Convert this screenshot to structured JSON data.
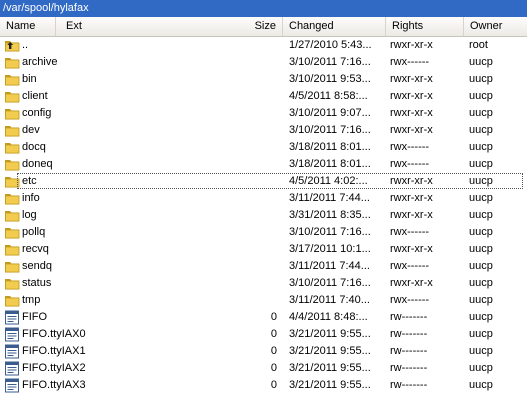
{
  "path": "/var/spool/hylafax",
  "columns": {
    "name": "Name",
    "ext": "Ext",
    "size": "Size",
    "changed": "Changed",
    "rights": "Rights",
    "owner": "Owner"
  },
  "colors": {
    "accent": "#316ac5",
    "folder": "#f2cc4e",
    "folder_dark": "#c49a1b"
  },
  "rows": [
    {
      "name": "..",
      "size": "",
      "changed": "1/27/2010 5:43...",
      "rights": "rwxr-xr-x",
      "owner": "root",
      "icon": "parent-folder-icon"
    },
    {
      "name": "archive",
      "size": "",
      "changed": "3/10/2011 7:16...",
      "rights": "rwx------",
      "owner": "uucp",
      "icon": "folder-icon"
    },
    {
      "name": "bin",
      "size": "",
      "changed": "3/10/2011 9:53...",
      "rights": "rwxr-xr-x",
      "owner": "uucp",
      "icon": "folder-icon"
    },
    {
      "name": "client",
      "size": "",
      "changed": "4/5/2011 8:58:...",
      "rights": "rwxr-xr-x",
      "owner": "uucp",
      "icon": "folder-icon"
    },
    {
      "name": "config",
      "size": "",
      "changed": "3/10/2011 9:07...",
      "rights": "rwxr-xr-x",
      "owner": "uucp",
      "icon": "folder-icon"
    },
    {
      "name": "dev",
      "size": "",
      "changed": "3/10/2011 7:16...",
      "rights": "rwxr-xr-x",
      "owner": "uucp",
      "icon": "folder-icon"
    },
    {
      "name": "docq",
      "size": "",
      "changed": "3/18/2011 8:01...",
      "rights": "rwx------",
      "owner": "uucp",
      "icon": "folder-icon"
    },
    {
      "name": "doneq",
      "size": "",
      "changed": "3/18/2011 8:01...",
      "rights": "rwx------",
      "owner": "uucp",
      "icon": "folder-icon"
    },
    {
      "name": "etc",
      "size": "",
      "changed": "4/5/2011 4:02:...",
      "rights": "rwxr-xr-x",
      "owner": "uucp",
      "icon": "folder-icon",
      "focused": true
    },
    {
      "name": "info",
      "size": "",
      "changed": "3/11/2011 7:44...",
      "rights": "rwxr-xr-x",
      "owner": "uucp",
      "icon": "folder-icon"
    },
    {
      "name": "log",
      "size": "",
      "changed": "3/31/2011 8:35...",
      "rights": "rwxr-xr-x",
      "owner": "uucp",
      "icon": "folder-icon"
    },
    {
      "name": "pollq",
      "size": "",
      "changed": "3/10/2011 7:16...",
      "rights": "rwx------",
      "owner": "uucp",
      "icon": "folder-icon"
    },
    {
      "name": "recvq",
      "size": "",
      "changed": "3/17/2011 10:1...",
      "rights": "rwxr-xr-x",
      "owner": "uucp",
      "icon": "folder-icon"
    },
    {
      "name": "sendq",
      "size": "",
      "changed": "3/11/2011 7:44...",
      "rights": "rwx------",
      "owner": "uucp",
      "icon": "folder-icon"
    },
    {
      "name": "status",
      "size": "",
      "changed": "3/10/2011 7:16...",
      "rights": "rwxr-xr-x",
      "owner": "uucp",
      "icon": "folder-icon"
    },
    {
      "name": "tmp",
      "size": "",
      "changed": "3/11/2011 7:40...",
      "rights": "rwx------",
      "owner": "uucp",
      "icon": "folder-icon"
    },
    {
      "name": "FIFO",
      "size": "0",
      "changed": "4/4/2011 8:48:...",
      "rights": "rw-------",
      "owner": "uucp",
      "icon": "fifo-file-icon"
    },
    {
      "name": "FIFO.ttyIAX0",
      "size": "0",
      "changed": "3/21/2011 9:55...",
      "rights": "rw-------",
      "owner": "uucp",
      "icon": "fifo-file-icon"
    },
    {
      "name": "FIFO.ttyIAX1",
      "size": "0",
      "changed": "3/21/2011 9:55...",
      "rights": "rw-------",
      "owner": "uucp",
      "icon": "fifo-file-icon"
    },
    {
      "name": "FIFO.ttyIAX2",
      "size": "0",
      "changed": "3/21/2011 9:55...",
      "rights": "rw-------",
      "owner": "uucp",
      "icon": "fifo-file-icon"
    },
    {
      "name": "FIFO.ttyIAX3",
      "size": "0",
      "changed": "3/21/2011 9:55...",
      "rights": "rw-------",
      "owner": "uucp",
      "icon": "fifo-file-icon"
    }
  ]
}
